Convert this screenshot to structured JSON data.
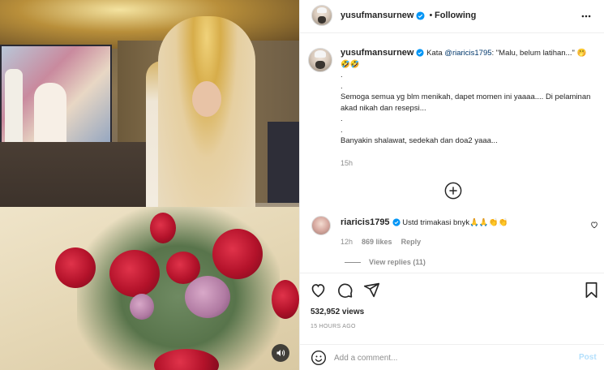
{
  "post": {
    "username": "yusufmansurnew",
    "following_label": "Following",
    "caption_lines": [
      "Kata ",
      "@riaricis1795",
      ": \"Malu, belum latihan...\" 🤭🤣🤣",
      ".",
      ".",
      "Semoga semua yg blm menikah, dapet momen ini yaaaa.... Di pelaminan akad nikah dan resepsi...",
      ".",
      ".",
      "Banyakin shalawat, sedekah dan doa2 yaaa..."
    ],
    "caption_time": "15h"
  },
  "comment": {
    "username": "riaricis1795",
    "text": "Ustd trimakasi bnyk🙏🙏👏👏",
    "time": "12h",
    "likes": "869 likes",
    "reply_label": "Reply",
    "view_replies": "View replies (11)"
  },
  "stats": {
    "views": "532,952 views",
    "posted": "15 HOURS AGO"
  },
  "composer": {
    "placeholder": "Add a comment...",
    "post_label": "Post"
  },
  "icons": {
    "header_more": "more-dots-icon",
    "load_more": "plus-circle-icon",
    "like": "heart-icon",
    "comment": "comment-bubble-icon",
    "share": "paper-plane-icon",
    "save": "bookmark-icon",
    "emoji": "smiley-icon",
    "audio": "speaker-icon",
    "verified": "verified-badge-icon"
  },
  "colors": {
    "verified": "#0095f6",
    "link": "#00376b",
    "muted": "#8e8e8e",
    "post_disabled": "#b2dffc"
  }
}
